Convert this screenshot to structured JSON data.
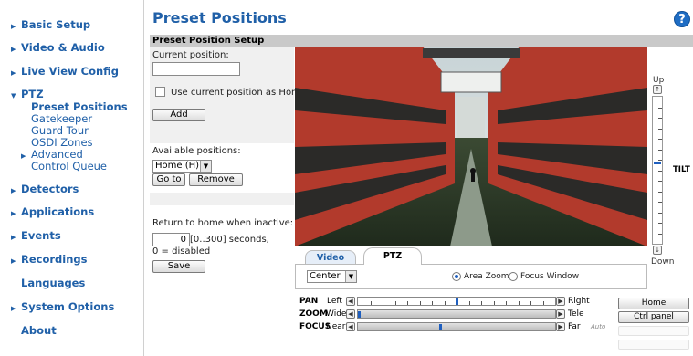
{
  "sidebar": {
    "items": [
      {
        "label": "Basic Setup",
        "arrow": "▶"
      },
      {
        "label": "Video & Audio",
        "arrow": "▶"
      },
      {
        "label": "Live View Config",
        "arrow": "▶"
      },
      {
        "label": "PTZ",
        "arrow": "▼"
      },
      {
        "label": "Detectors",
        "arrow": "▶"
      },
      {
        "label": "Applications",
        "arrow": "▶"
      },
      {
        "label": "Events",
        "arrow": "▶"
      },
      {
        "label": "Recordings",
        "arrow": "▶"
      },
      {
        "label": "Languages"
      },
      {
        "label": "System Options",
        "arrow": "▶"
      },
      {
        "label": "About"
      }
    ],
    "ptz_sub": [
      {
        "label": "Preset Positions"
      },
      {
        "label": "Gatekeeper"
      },
      {
        "label": "Guard Tour"
      },
      {
        "label": "OSDI Zones"
      },
      {
        "label": "Advanced",
        "arrow": "▶"
      },
      {
        "label": "Control Queue"
      }
    ]
  },
  "header": {
    "title": "Preset Positions",
    "help": "?"
  },
  "setup": {
    "section_title": "Preset Position Setup",
    "current_position_label": "Current position:",
    "current_position_value": "",
    "use_current_label": "Use current position as Home",
    "use_current_checked": false,
    "add_label": "Add",
    "available_label": "Available positions:",
    "available_selected": "Home (H)",
    "goto_label": "Go to",
    "remove_label": "Remove",
    "return_label": "Return to home when inactive:",
    "return_value": "0",
    "return_range": "[0..300] seconds,",
    "return_note": "0 = disabled",
    "save_label": "Save"
  },
  "tilt": {
    "up": "Up",
    "down": "Down",
    "label": "TILT",
    "up_arrow": "↑",
    "down_arrow": "↓",
    "level": 0.45
  },
  "tabs": [
    {
      "label": "Video"
    },
    {
      "label": "PTZ",
      "active": true
    }
  ],
  "ptz_panel": {
    "center_select": "Center",
    "area_zoom_label": "Area Zoom",
    "focus_window_label": "Focus Window",
    "area_zoom_selected": true
  },
  "sliders": {
    "pan": {
      "name": "PAN",
      "left": "Left",
      "right": "Right",
      "level": 0.5
    },
    "zoom": {
      "name": "ZOOM",
      "left": "Wide",
      "right": "Tele",
      "level": 0.0
    },
    "focus": {
      "name": "FOCUS",
      "left": "Near",
      "right": "Far",
      "extra": "Auto",
      "level": 0.42
    }
  },
  "side_buttons": {
    "home": "Home",
    "ctrl_panel": "Ctrl panel"
  },
  "colors": {
    "link": "#2060a8",
    "thumb": "#1f5fbf",
    "building_red": "#b23a2c"
  }
}
